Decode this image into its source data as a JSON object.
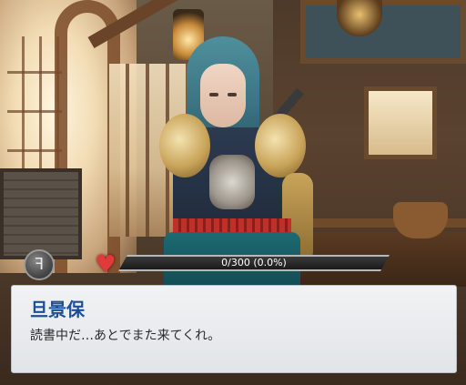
{
  "hud": {
    "bond_icon": "bond-rank-icon",
    "heart_icon": "heart-icon",
    "gauge": {
      "text": "0/300 (0.0%)",
      "current": 0,
      "max": 300,
      "fill_fraction": 0.0,
      "fill_color": "#e05a7a"
    }
  },
  "dialog": {
    "speaker": "旦景保",
    "line": "読書中だ…あとでまた来てくれ。",
    "speaker_color": "#1c4f9a"
  },
  "colors": {
    "heart": "#e03a3a",
    "dialog_bg": "#f4f6f8"
  }
}
